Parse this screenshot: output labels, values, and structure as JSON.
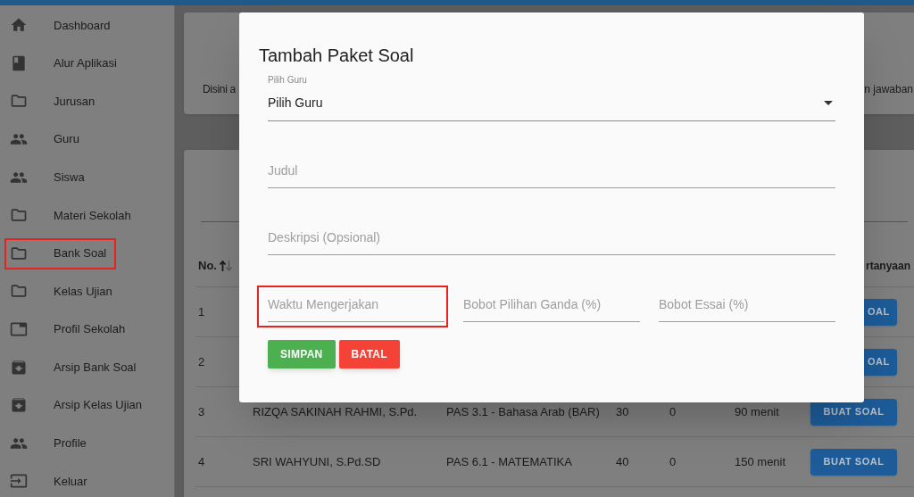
{
  "sidebar": {
    "items": [
      {
        "label": "Dashboard",
        "highlighted": false
      },
      {
        "label": "Alur Aplikasi",
        "highlighted": false
      },
      {
        "label": "Jurusan",
        "highlighted": false
      },
      {
        "label": "Guru",
        "highlighted": false
      },
      {
        "label": "Siswa",
        "highlighted": false
      },
      {
        "label": "Materi Sekolah",
        "highlighted": false
      },
      {
        "label": "Bank Soal",
        "highlighted": true
      },
      {
        "label": "Kelas Ujian",
        "highlighted": false
      },
      {
        "label": "Profil Sekolah",
        "highlighted": false
      },
      {
        "label": "Arsip Bank Soal",
        "highlighted": false
      },
      {
        "label": "Arsip Kelas Ujian",
        "highlighted": false
      },
      {
        "label": "Profile",
        "highlighted": false
      },
      {
        "label": "Keluar",
        "highlighted": false
      }
    ]
  },
  "info_card": {
    "text_left": "Disini a",
    "text_right": "n jawaban"
  },
  "table": {
    "header": {
      "column_1": "No.",
      "column_1_sorted_ascending": true,
      "column_8": "rtanyaan"
    },
    "rows": [
      {
        "kind": "covered",
        "cells": [
          "1"
        ],
        "button": "OAL"
      },
      {
        "kind": "covered",
        "cells": [
          "2"
        ],
        "button": "OAL"
      },
      {
        "kind": "full",
        "cells": [
          "3",
          "RIZQA SAKINAH RAHMI, S.Pd.",
          "PAS 3.1 - Bahasa Arab (BAR)",
          "30",
          "0",
          "90 menit"
        ],
        "button": "BUAT SOAL"
      },
      {
        "kind": "full",
        "cells": [
          "4",
          "SRI WAHYUNI, S.Pd.SD",
          "PAS 6.1 - MATEMATIKA",
          "40",
          "0",
          "150 menit"
        ],
        "button": "BUAT SOAL"
      }
    ]
  },
  "dialog": {
    "title": "Tambah Paket Soal",
    "select": {
      "label": "Pilih Guru",
      "value": "Pilih Guru"
    },
    "fields": [
      {
        "placeholder": "Judul",
        "highlighted": false
      },
      {
        "placeholder": "Deskripsi (Opsional)",
        "highlighted": false
      }
    ],
    "row_fields": [
      {
        "placeholder": "Waktu Mengerjakan",
        "highlighted": true
      },
      {
        "placeholder": "Bobot Pilihan Ganda (%)",
        "highlighted": false
      },
      {
        "placeholder": "Bobot Essai (%)",
        "highlighted": false
      }
    ],
    "buttons": [
      {
        "label": "SIMPAN",
        "kind": "save"
      },
      {
        "label": "BATAL",
        "kind": "cancel"
      }
    ]
  }
}
